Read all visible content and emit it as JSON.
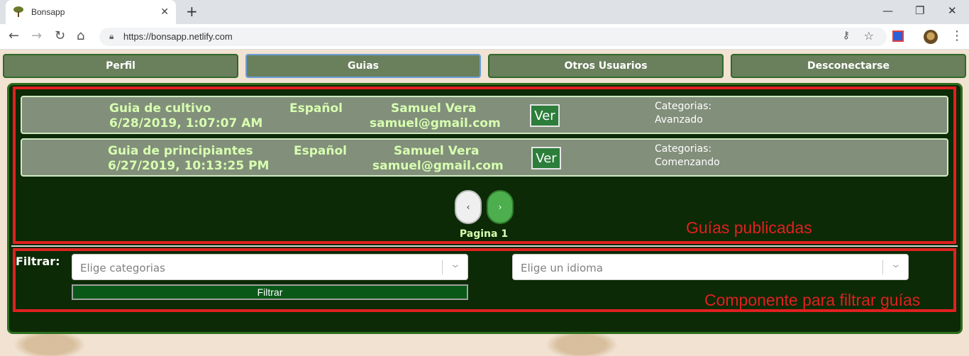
{
  "browser": {
    "tab_title": "Bonsapp",
    "tab_close": "✕",
    "new_tab": "+",
    "url": "https://bonsapp.netlify.com",
    "controls": {
      "minimize": "—",
      "maximize": "❐",
      "close": "✕"
    }
  },
  "nav": {
    "items": [
      {
        "label": "Perfil",
        "active": false
      },
      {
        "label": "Guias",
        "active": true
      },
      {
        "label": "Otros Usuarios",
        "active": false
      },
      {
        "label": "Desconectarse",
        "active": false
      }
    ]
  },
  "guides": [
    {
      "title": "Guia de cultivo",
      "date": "6/28/2019, 1:07:07 AM",
      "language": "Español",
      "author": "Samuel Vera",
      "email": "samuel@gmail.com",
      "view_label": "Ver",
      "categories_label": "Categorias:",
      "category": "Avanzado"
    },
    {
      "title": "Guia de principiantes",
      "date": "6/27/2019, 10:13:25 PM",
      "language": "Español",
      "author": "Samuel Vera",
      "email": "samuel@gmail.com",
      "view_label": "Ver",
      "categories_label": "Categorias:",
      "category": "Comenzando"
    }
  ],
  "pagination": {
    "prev": "‹",
    "next": "›",
    "label": "Pagina 1"
  },
  "annotations": {
    "published": "Guías publicadas",
    "filter_component": "Componente para filtrar guías"
  },
  "filter": {
    "label": "Filtrar:",
    "category_placeholder": "Elige categorias",
    "language_placeholder": "Elige un idioma",
    "button": "Filtrar"
  }
}
